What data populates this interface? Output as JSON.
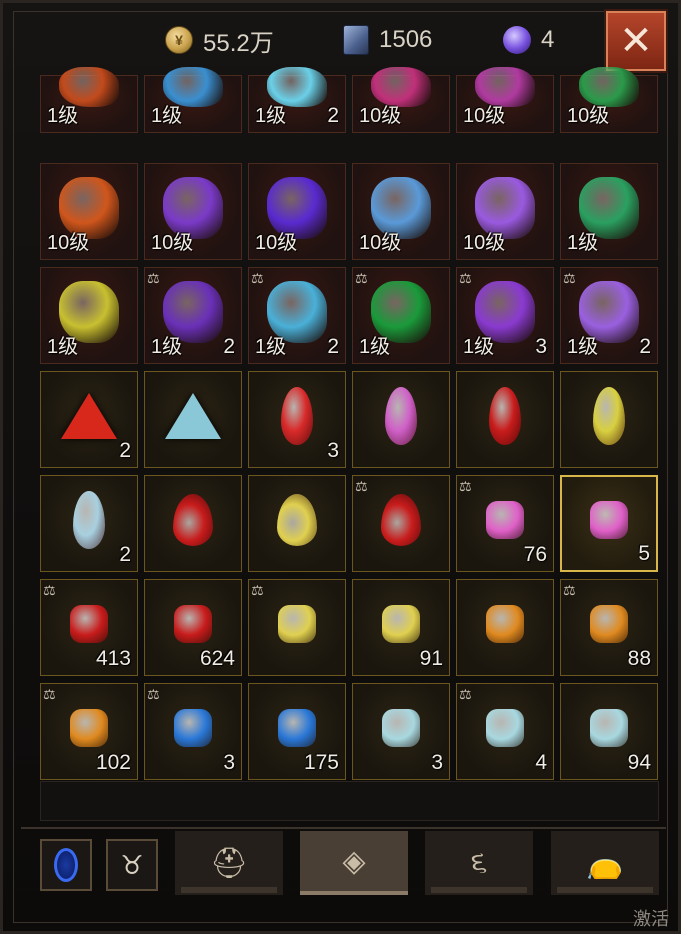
{
  "currency": {
    "gold": "55.2万",
    "scrolls": "1506",
    "orbs": "4"
  },
  "close_label": "✕",
  "rows": [
    [
      {
        "t": "eq",
        "lvl": "1级",
        "c": "",
        "color": "#c24a1c"
      },
      {
        "t": "eq",
        "lvl": "1级",
        "c": "",
        "color": "#3a8fd0"
      },
      {
        "t": "eq",
        "lvl": "1级",
        "c": "2",
        "color": "#6ad0e8"
      },
      {
        "t": "eq",
        "lvl": "10级",
        "c": "",
        "color": "#c0307a"
      },
      {
        "t": "eq",
        "lvl": "10级",
        "c": "",
        "color": "#b03aa0"
      },
      {
        "t": "eq",
        "lvl": "10级",
        "c": "",
        "color": "#2a9a4a"
      }
    ],
    [
      {
        "t": "eq",
        "lvl": "10级",
        "c": "",
        "color": "#d0561c"
      },
      {
        "t": "eq",
        "lvl": "10级",
        "c": "",
        "color": "#7a3ac8"
      },
      {
        "t": "eq",
        "lvl": "10级",
        "c": "",
        "color": "#5a2ad0"
      },
      {
        "t": "eq",
        "lvl": "10级",
        "c": "",
        "color": "#5a9ad8"
      },
      {
        "t": "eq",
        "lvl": "10级",
        "c": "",
        "color": "#9a5ae0"
      },
      {
        "t": "eq",
        "lvl": "1级",
        "c": "",
        "color": "#2aa060"
      }
    ],
    [
      {
        "t": "eq",
        "lvl": "1级",
        "c": "",
        "color": "#c8c030",
        "scale": false
      },
      {
        "t": "eq",
        "lvl": "1级",
        "c": "2",
        "color": "#6a30b8",
        "scale": true
      },
      {
        "t": "eq",
        "lvl": "1级",
        "c": "2",
        "color": "#4ab0d8",
        "scale": true
      },
      {
        "t": "eq",
        "lvl": "1级",
        "c": "",
        "color": "#1a9a3a",
        "scale": true
      },
      {
        "t": "eq",
        "lvl": "1级",
        "c": "3",
        "color": "#8a3ad0",
        "scale": true
      },
      {
        "t": "eq",
        "lvl": "1级",
        "c": "2",
        "color": "#9a60e0",
        "scale": true
      }
    ],
    [
      {
        "t": "gm",
        "shape": "tri",
        "c": "2",
        "color": "#d8281c"
      },
      {
        "t": "gm",
        "shape": "tri",
        "c": "",
        "color": "#8ac8d8"
      },
      {
        "t": "gm",
        "shape": "leaf",
        "c": "3",
        "color": "#d82a2a"
      },
      {
        "t": "gm",
        "shape": "leaf",
        "c": "",
        "color": "#d060c8"
      },
      {
        "t": "gm",
        "shape": "leaf",
        "c": "",
        "color": "#c81c1c"
      },
      {
        "t": "gm",
        "shape": "leaf",
        "c": "",
        "color": "#d8d040"
      }
    ],
    [
      {
        "t": "gm",
        "shape": "leaf",
        "c": "2",
        "color": "#a8d0e0"
      },
      {
        "t": "gm",
        "shape": "drop",
        "c": "",
        "color": "#c81c1c"
      },
      {
        "t": "gm",
        "shape": "drop",
        "c": "",
        "color": "#e0d050"
      },
      {
        "t": "gm",
        "shape": "drop",
        "c": "",
        "color": "#c81c1c",
        "scale": true
      },
      {
        "t": "gm",
        "shape": "chip",
        "c": "76",
        "color": "#e060c8",
        "scale": true
      },
      {
        "t": "gm",
        "shape": "chip",
        "c": "5",
        "color": "#e060c8",
        "sel": true
      }
    ],
    [
      {
        "t": "gm",
        "shape": "chip",
        "c": "413",
        "color": "#c81c1c",
        "scale": true
      },
      {
        "t": "gm",
        "shape": "chip",
        "c": "624",
        "color": "#c81c1c"
      },
      {
        "t": "gm",
        "shape": "chip",
        "c": "",
        "color": "#e0d050",
        "scale": true
      },
      {
        "t": "gm",
        "shape": "chip",
        "c": "91",
        "color": "#e0d050"
      },
      {
        "t": "gm",
        "shape": "chip",
        "c": "",
        "color": "#e08a20"
      },
      {
        "t": "gm",
        "shape": "chip",
        "c": "88",
        "color": "#e08a20",
        "scale": true
      }
    ],
    [
      {
        "t": "gm",
        "shape": "chip",
        "c": "102",
        "color": "#e08a20",
        "scale": true
      },
      {
        "t": "gm",
        "shape": "chip",
        "c": "3",
        "color": "#2a78d8",
        "scale": true
      },
      {
        "t": "gm",
        "shape": "chip",
        "c": "175",
        "color": "#2a78d8"
      },
      {
        "t": "gm",
        "shape": "chip",
        "c": "3",
        "color": "#a8d8e0"
      },
      {
        "t": "gm",
        "shape": "chip",
        "c": "4",
        "color": "#a8d8e0",
        "scale": true
      },
      {
        "t": "gm",
        "shape": "chip",
        "c": "94",
        "color": "#a8d8e0"
      }
    ]
  ],
  "tabs": [
    {
      "name": "tab-equipment",
      "icon": "helmet-icon",
      "active": false
    },
    {
      "name": "tab-gems",
      "icon": "gem-icon",
      "active": true
    },
    {
      "name": "tab-consumables",
      "icon": "swirl-icon",
      "active": false
    },
    {
      "name": "tab-bag",
      "icon": "bag-icon",
      "active": false
    }
  ],
  "watermark": "激活 V"
}
